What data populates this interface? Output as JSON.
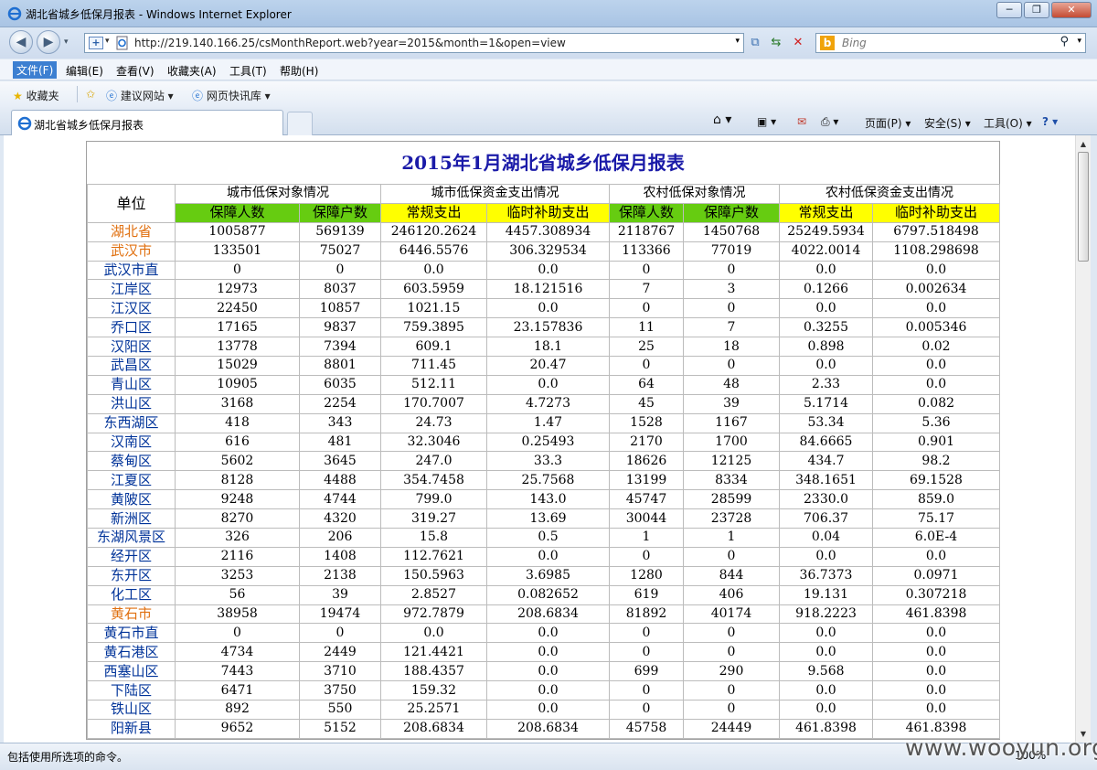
{
  "window": {
    "title": "湖北省城乡低保月报表 - Windows Internet Explorer",
    "minimize": "─",
    "restore": "❐",
    "close": "✕"
  },
  "address": {
    "url": "http://219.140.166.25/csMonthReport.web?year=2015&month=1&open=view",
    "search_placeholder": "Bing"
  },
  "menu": [
    "文件(F)",
    "编辑(E)",
    "查看(V)",
    "收藏夹(A)",
    "工具(T)",
    "帮助(H)"
  ],
  "favorites": {
    "label": "收藏夹",
    "suggested": "建议网站 ▾",
    "webslice": "网页快讯库 ▾"
  },
  "tab": {
    "title": "湖北省城乡低保月报表"
  },
  "commandbar": {
    "page": "页面(P) ▾",
    "safety": "安全(S) ▾",
    "tools": "工具(O) ▾",
    "help": "? ▾"
  },
  "report": {
    "title": "2015年1月湖北省城乡低保月报表",
    "unit_header": "单位",
    "groups": [
      "城市低保对象情况",
      "城市低保资金支出情况",
      "农村低保对象情况",
      "农村低保资金支出情况"
    ],
    "subheaders": [
      "保障人数",
      "保障户数",
      "常规支出",
      "临时补助支出",
      "保障人数",
      "保障户数",
      "常规支出",
      "临时补助支出"
    ],
    "rows": [
      {
        "name": "湖北省",
        "level": "prov",
        "v": [
          "1005877",
          "569139",
          "246120.2624",
          "4457.308934",
          "2118767",
          "1450768",
          "25249.5934",
          "6797.518498"
        ]
      },
      {
        "name": "武汉市",
        "level": "city",
        "v": [
          "133501",
          "75027",
          "6446.5576",
          "306.329534",
          "113366",
          "77019",
          "4022.0014",
          "1108.298698"
        ]
      },
      {
        "name": "武汉市直",
        "level": "dist",
        "v": [
          "0",
          "0",
          "0.0",
          "0.0",
          "0",
          "0",
          "0.0",
          "0.0"
        ]
      },
      {
        "name": "江岸区",
        "level": "dist",
        "v": [
          "12973",
          "8037",
          "603.5959",
          "18.121516",
          "7",
          "3",
          "0.1266",
          "0.002634"
        ]
      },
      {
        "name": "江汉区",
        "level": "dist",
        "v": [
          "22450",
          "10857",
          "1021.15",
          "0.0",
          "0",
          "0",
          "0.0",
          "0.0"
        ]
      },
      {
        "name": "乔口区",
        "level": "dist",
        "v": [
          "17165",
          "9837",
          "759.3895",
          "23.157836",
          "11",
          "7",
          "0.3255",
          "0.005346"
        ]
      },
      {
        "name": "汉阳区",
        "level": "dist",
        "v": [
          "13778",
          "7394",
          "609.1",
          "18.1",
          "25",
          "18",
          "0.898",
          "0.02"
        ]
      },
      {
        "name": "武昌区",
        "level": "dist",
        "v": [
          "15029",
          "8801",
          "711.45",
          "20.47",
          "0",
          "0",
          "0.0",
          "0.0"
        ]
      },
      {
        "name": "青山区",
        "level": "dist",
        "v": [
          "10905",
          "6035",
          "512.11",
          "0.0",
          "64",
          "48",
          "2.33",
          "0.0"
        ]
      },
      {
        "name": "洪山区",
        "level": "dist",
        "v": [
          "3168",
          "2254",
          "170.7007",
          "4.7273",
          "45",
          "39",
          "5.1714",
          "0.082"
        ]
      },
      {
        "name": "东西湖区",
        "level": "dist",
        "v": [
          "418",
          "343",
          "24.73",
          "1.47",
          "1528",
          "1167",
          "53.34",
          "5.36"
        ]
      },
      {
        "name": "汉南区",
        "level": "dist",
        "v": [
          "616",
          "481",
          "32.3046",
          "0.25493",
          "2170",
          "1700",
          "84.6665",
          "0.901"
        ]
      },
      {
        "name": "蔡甸区",
        "level": "dist",
        "v": [
          "5602",
          "3645",
          "247.0",
          "33.3",
          "18626",
          "12125",
          "434.7",
          "98.2"
        ]
      },
      {
        "name": "江夏区",
        "level": "dist",
        "v": [
          "8128",
          "4488",
          "354.7458",
          "25.7568",
          "13199",
          "8334",
          "348.1651",
          "69.1528"
        ]
      },
      {
        "name": "黄陂区",
        "level": "dist",
        "v": [
          "9248",
          "4744",
          "799.0",
          "143.0",
          "45747",
          "28599",
          "2330.0",
          "859.0"
        ]
      },
      {
        "name": "新洲区",
        "level": "dist",
        "v": [
          "8270",
          "4320",
          "319.27",
          "13.69",
          "30044",
          "23728",
          "706.37",
          "75.17"
        ]
      },
      {
        "name": "东湖风景区",
        "level": "dist",
        "v": [
          "326",
          "206",
          "15.8",
          "0.5",
          "1",
          "1",
          "0.04",
          "6.0E-4"
        ]
      },
      {
        "name": "经开区",
        "level": "dist",
        "v": [
          "2116",
          "1408",
          "112.7621",
          "0.0",
          "0",
          "0",
          "0.0",
          "0.0"
        ]
      },
      {
        "name": "东开区",
        "level": "dist",
        "v": [
          "3253",
          "2138",
          "150.5963",
          "3.6985",
          "1280",
          "844",
          "36.7373",
          "0.0971"
        ]
      },
      {
        "name": "化工区",
        "level": "dist",
        "v": [
          "56",
          "39",
          "2.8527",
          "0.082652",
          "619",
          "406",
          "19.131",
          "0.307218"
        ]
      },
      {
        "name": "黄石市",
        "level": "city",
        "v": [
          "38958",
          "19474",
          "972.7879",
          "208.6834",
          "81892",
          "40174",
          "918.2223",
          "461.8398"
        ]
      },
      {
        "name": "黄石市直",
        "level": "dist",
        "v": [
          "0",
          "0",
          "0.0",
          "0.0",
          "0",
          "0",
          "0.0",
          "0.0"
        ]
      },
      {
        "name": "黄石港区",
        "level": "dist",
        "v": [
          "4734",
          "2449",
          "121.4421",
          "0.0",
          "0",
          "0",
          "0.0",
          "0.0"
        ]
      },
      {
        "name": "西塞山区",
        "level": "dist",
        "v": [
          "7443",
          "3710",
          "188.4357",
          "0.0",
          "699",
          "290",
          "9.568",
          "0.0"
        ]
      },
      {
        "name": "下陆区",
        "level": "dist",
        "v": [
          "6471",
          "3750",
          "159.32",
          "0.0",
          "0",
          "0",
          "0.0",
          "0.0"
        ]
      },
      {
        "name": "铁山区",
        "level": "dist",
        "v": [
          "892",
          "550",
          "25.2571",
          "0.0",
          "0",
          "0",
          "0.0",
          "0.0"
        ]
      },
      {
        "name": "阳新县",
        "level": "dist",
        "v": [
          "9652",
          "5152",
          "208.6834",
          "208.6834",
          "45758",
          "24449",
          "461.8398",
          "461.8398"
        ]
      }
    ]
  },
  "status": {
    "text": "包括使用所选项的命令。",
    "zoom": "100%"
  },
  "watermark": "www.wooyun.org"
}
